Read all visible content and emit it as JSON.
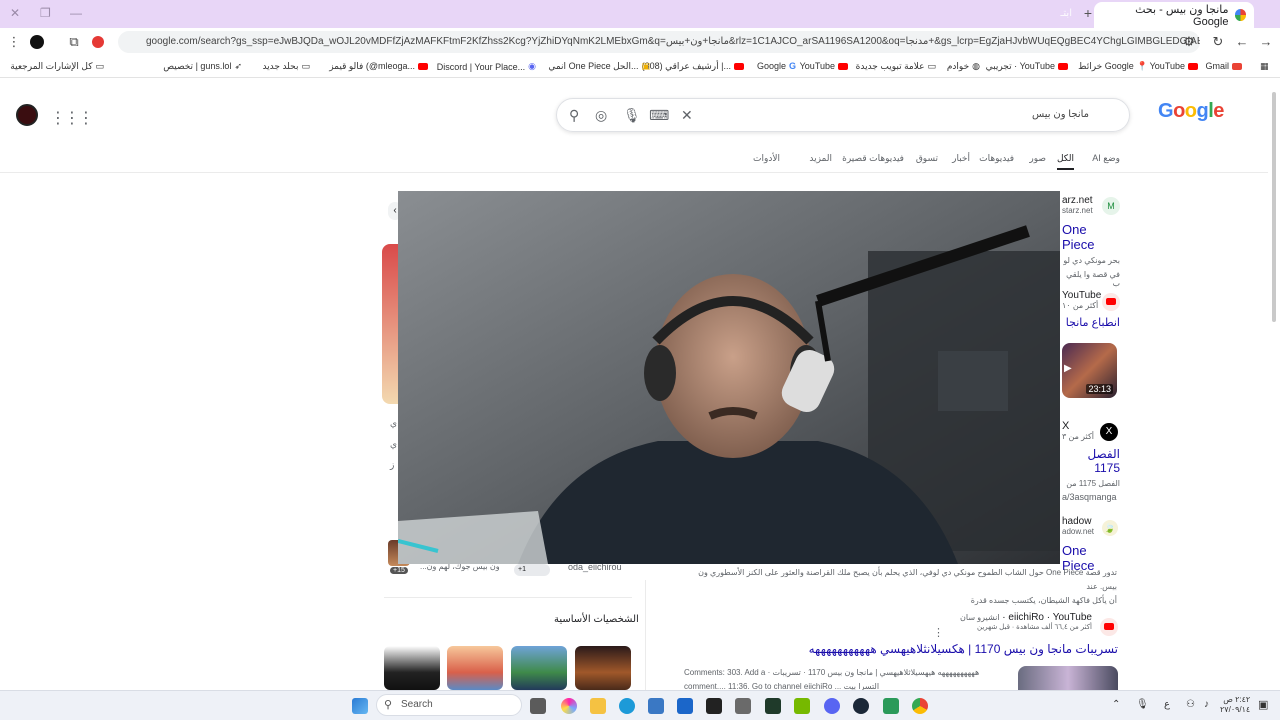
{
  "tab": {
    "title": "مانجا ون بيس - بحث Google",
    "ghost": "ابتـ"
  },
  "omnibox": {
    "url": "google.com/search?gs_ssp=eJwBJQDa_wOJL20vMDFfZjAzMAFKFtmF2KfZhss2Kcg?YjZhiDYqNmK2LMEbxGm&q=مانجا+ون+بيس&rlz=1C1AJCO_arSA1196SA1200&oq=مدنجا+&gs_lcrp=EgZjaHJvbWUqEQgBEC4YChgLGIMBGLEDGIAEMgYIABBFGDkyEQg..."
  },
  "bookmarks": [
    {
      "label": "Gmail",
      "icon": "gmail"
    },
    {
      "label": "YouTube",
      "icon": "youtube"
    },
    {
      "label": "خرائط Google",
      "icon": "maps"
    },
    {
      "label": "تجريبي · YouTube",
      "icon": "youtube"
    },
    {
      "label": "خوادم",
      "icon": "globe"
    },
    {
      "label": "علامة تبويب جديدة",
      "icon": "youtube"
    },
    {
      "label": "YouTube",
      "icon": "youtube"
    },
    {
      "label": "Google",
      "icon": "google"
    },
    {
      "label": "(308) أرشيف عراقي |...",
      "icon": "youtube"
    },
    {
      "label": "انمي One Piece الحل...",
      "icon": "folder"
    },
    {
      "label": "Discord | Your Place...",
      "icon": "discord"
    },
    {
      "label": "فالو قيمز (@mleoga...",
      "icon": "youtube"
    },
    {
      "label": "بحلد جديد",
      "icon": "folder"
    },
    {
      "label": "تخصيص | guns.lol",
      "icon": "rocket"
    },
    {
      "label": "كل الإشارات المرجعية",
      "icon": "folder"
    }
  ],
  "search": {
    "query": "مانجا ون بيس"
  },
  "logo": "Google",
  "nav": [
    "وضع AI",
    "الكل",
    "صور",
    "فيديوهات",
    "أخبار",
    "تسوق",
    "فيديوهات قصيرة",
    "المزيد",
    "الأدوات"
  ],
  "results": [
    {
      "site": "arz.net",
      "url": "starz.net",
      "title": "One Piece",
      "snippet1": "بحر مونكي دي لو",
      "snippet2": "في قصة وا يلقي ب"
    },
    {
      "site": "YouTube",
      "url": "أكثر من ١٠",
      "title": "انطباع مانجا",
      "duration": "23:13"
    },
    {
      "site": "X",
      "url": "أكثر من ٣",
      "title": "الفصل 1175",
      "snippet1": "الفصل 1175 من",
      "snippet2": "a/3asqmanga"
    },
    {
      "site": "hadow",
      "url": "adow.net",
      "title": "One Piece",
      "snippet1": "تدور قصة One Piece حول الشاب الطموح مونكي دي لوفي، الذي يحلم بأن يصبح ملك القراصنة والعثور على الكنز الأسطوري ون بيس. عند",
      "snippet2": "أن يأكل فاكهة الشيطان، يكتسب جسده قدرة"
    },
    {
      "site": "eiichiRo · YouTube",
      "channel": "انشيرو سان",
      "url": "أكثر من ٦٦,٤ ألف مشاهدة · قبل شهرين",
      "title": "تسريبات مانجا ون بيس 1170 | هكسيلانثلاهيهسي هههههههههههه",
      "snippet1": "Comments: 303. Add a · ههههههههههه هيهسيلاثلاهيهسي | مانجا ون بيس 1170 · تسريبات",
      "snippet2": "comment.... 11:36. Go to channel eiichiRo ... التسرا بيت"
    }
  ],
  "left": {
    "chars_title": "الشخصيات الأساسية",
    "more_label": "+15",
    "plus_one": "+1",
    "caption1": "ون بيس جوك، لهم ون...",
    "caption2": "oda_eiichirou"
  },
  "taskbar": {
    "search_placeholder": "Search",
    "time": "٢:٤٢ ص",
    "date": "٢٧/٠٩/١٤"
  },
  "colors": {
    "tab_strip": "#e8d6f7",
    "link": "#1a0dab"
  }
}
